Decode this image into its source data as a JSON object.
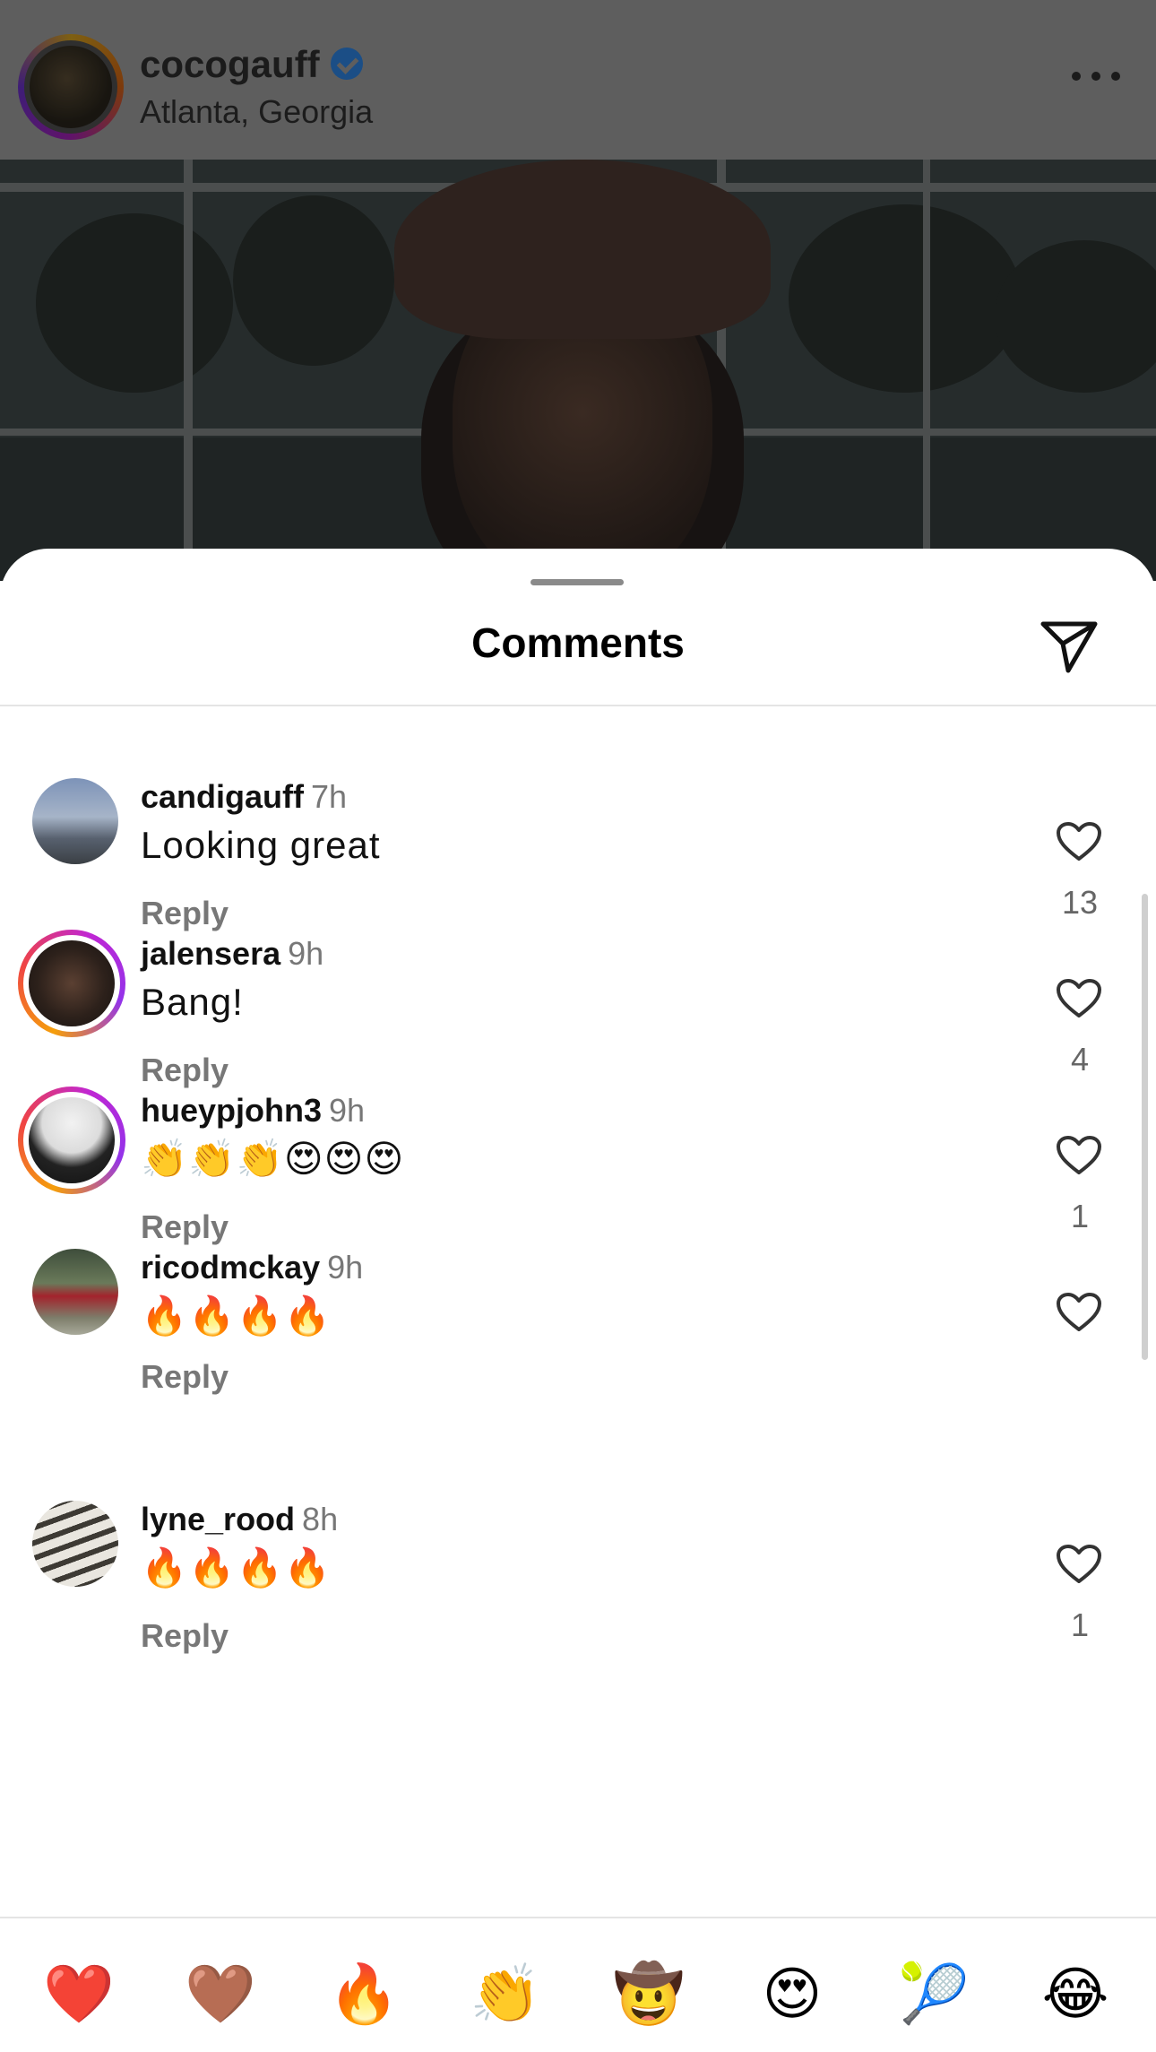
{
  "post": {
    "username": "cocogauff",
    "verified_icon": "verified-badge-icon",
    "location": "Atlanta, Georgia",
    "more_icon": "more-horizontal-icon"
  },
  "sheet": {
    "title": "Comments",
    "share_icon": "send-icon"
  },
  "comments": [
    {
      "user": "candigauff",
      "time": "7h",
      "text": "Looking great",
      "reply_label": "Reply",
      "likes": "13",
      "story_ring": false
    },
    {
      "user": "jalensera",
      "time": "9h",
      "text": "Bang!",
      "reply_label": "Reply",
      "likes": "4",
      "story_ring": true
    },
    {
      "user": "hueypjohn3",
      "time": "9h",
      "text": "👏👏👏😍😍😍",
      "reply_label": "Reply",
      "likes": "1",
      "story_ring": true
    },
    {
      "user": "ricodmckay",
      "time": "9h",
      "text": "🔥🔥🔥🔥",
      "reply_label": "Reply",
      "likes": "",
      "story_ring": false
    },
    {
      "user": "lyne_rood",
      "time": "8h",
      "text": "🔥🔥🔥🔥",
      "reply_label": "Reply",
      "likes": "1",
      "story_ring": false
    }
  ],
  "quick_emojis": [
    "❤️",
    "🤎",
    "🔥",
    "👏",
    "🤠",
    "😍",
    "🎾",
    "😂"
  ],
  "colors": {
    "text": "#111111",
    "muted": "#777777",
    "divider": "#e4e4e4",
    "story_ring_start": "#f59e0b",
    "story_ring_end": "#9333ea",
    "verified_blue": "#1b4e86"
  }
}
